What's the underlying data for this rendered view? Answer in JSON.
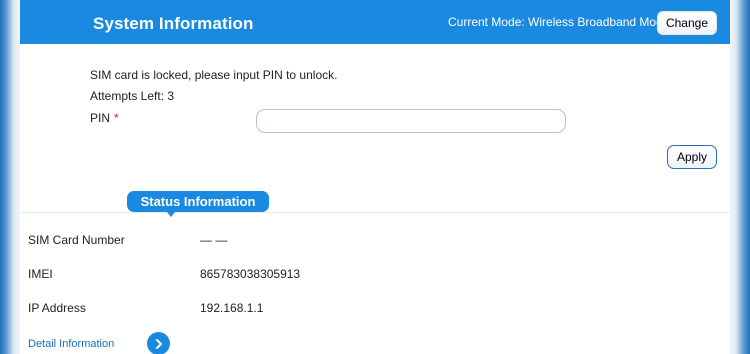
{
  "header": {
    "title": "System Information",
    "mode_text": "Current Mode: Wireless Broadband Mode",
    "change_label": "Change"
  },
  "pin_section": {
    "message": "SIM card is locked, please input PIN to unlock.",
    "attempts": "Attempts Left: 3",
    "pin_label": "PIN",
    "required_mark": "*",
    "pin_value": "",
    "apply_label": "Apply"
  },
  "status": {
    "title": "Status Information",
    "rows": [
      {
        "label": "SIM Card Number",
        "value": "— —"
      },
      {
        "label": "IMEI",
        "value": "865783038305913"
      },
      {
        "label": "IP Address",
        "value": "192.168.1.1"
      }
    ],
    "detail_link": "Detail Information"
  },
  "icons": {
    "detail_arrow": "chevron-right-icon"
  },
  "colors": {
    "header_blue": "#1a8ae0",
    "required_red": "#e0261a",
    "link_blue": "#1a6fc0"
  }
}
